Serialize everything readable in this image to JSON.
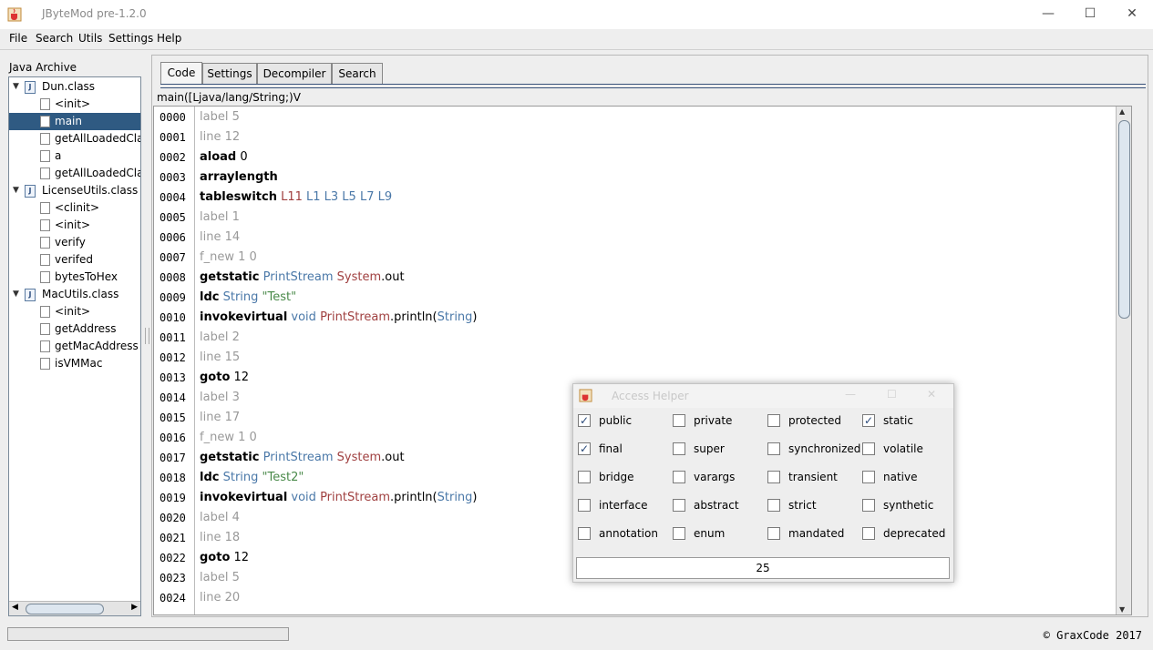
{
  "window": {
    "title": "JByteMod pre-1.2.0",
    "minimize": "—",
    "maximize": "☐",
    "close": "✕"
  },
  "menu": [
    "File",
    "Search",
    "Utils",
    "Settings",
    "Help"
  ],
  "tree": {
    "heading": "Java Archive",
    "rows": [
      {
        "type": "class",
        "label": "Dun.class"
      },
      {
        "type": "method",
        "label": "<init>"
      },
      {
        "type": "method",
        "label": "main",
        "selected": true
      },
      {
        "type": "method",
        "label": "getAllLoadedClasses"
      },
      {
        "type": "method",
        "label": "a"
      },
      {
        "type": "method",
        "label": "getAllLoadedClasses"
      },
      {
        "type": "class",
        "label": "LicenseUtils.class"
      },
      {
        "type": "method",
        "label": "<clinit>"
      },
      {
        "type": "method",
        "label": "<init>"
      },
      {
        "type": "method",
        "label": "verify"
      },
      {
        "type": "method",
        "label": "verifed"
      },
      {
        "type": "method",
        "label": "bytesToHex"
      },
      {
        "type": "class",
        "label": "MacUtils.class"
      },
      {
        "type": "method",
        "label": "<init>"
      },
      {
        "type": "method",
        "label": "getAddress"
      },
      {
        "type": "method",
        "label": "getMacAddress"
      },
      {
        "type": "method",
        "label": "isVMMac"
      }
    ]
  },
  "tabs": [
    "Code",
    "Settings",
    "Decompiler",
    "Search"
  ],
  "method_signature": "main([Ljava/lang/String;)V",
  "code": [
    {
      "num": "0000",
      "parts": [
        [
          "label",
          "label 5"
        ]
      ]
    },
    {
      "num": "0001",
      "parts": [
        [
          "label",
          "line 12"
        ]
      ]
    },
    {
      "num": "0002",
      "parts": [
        [
          "op",
          "aload"
        ],
        [
          "plain",
          " 0"
        ]
      ]
    },
    {
      "num": "0003",
      "parts": [
        [
          "op",
          "arraylength"
        ]
      ]
    },
    {
      "num": "0004",
      "parts": [
        [
          "op",
          "tableswitch"
        ],
        [
          "owner",
          " L11"
        ],
        [
          "type",
          " L1 L3 L5 L7 L9"
        ]
      ]
    },
    {
      "num": "0005",
      "parts": [
        [
          "label",
          "label 1"
        ]
      ]
    },
    {
      "num": "0006",
      "parts": [
        [
          "label",
          "line 14"
        ]
      ]
    },
    {
      "num": "0007",
      "parts": [
        [
          "label",
          "f_new 1 0"
        ]
      ]
    },
    {
      "num": "0008",
      "parts": [
        [
          "op",
          "getstatic"
        ],
        [
          "type",
          " PrintStream"
        ],
        [
          "owner",
          " System"
        ],
        [
          "plain",
          ".out"
        ]
      ]
    },
    {
      "num": "0009",
      "parts": [
        [
          "op",
          "ldc"
        ],
        [
          "type",
          " String"
        ],
        [
          "str",
          " \"Test\""
        ]
      ]
    },
    {
      "num": "0010",
      "parts": [
        [
          "op",
          "invokevirtual"
        ],
        [
          "type",
          " void"
        ],
        [
          "owner",
          " PrintStream"
        ],
        [
          "plain",
          ".println("
        ],
        [
          "type",
          "String"
        ],
        [
          "plain",
          ")"
        ]
      ]
    },
    {
      "num": "0011",
      "parts": [
        [
          "label",
          "label 2"
        ]
      ]
    },
    {
      "num": "0012",
      "parts": [
        [
          "label",
          "line 15"
        ]
      ]
    },
    {
      "num": "0013",
      "parts": [
        [
          "op",
          "goto"
        ],
        [
          "plain",
          " 12"
        ]
      ]
    },
    {
      "num": "0014",
      "parts": [
        [
          "label",
          "label 3"
        ]
      ]
    },
    {
      "num": "0015",
      "parts": [
        [
          "label",
          "line 17"
        ]
      ]
    },
    {
      "num": "0016",
      "parts": [
        [
          "label",
          "f_new 1 0"
        ]
      ]
    },
    {
      "num": "0017",
      "parts": [
        [
          "op",
          "getstatic"
        ],
        [
          "type",
          " PrintStream"
        ],
        [
          "owner",
          " System"
        ],
        [
          "plain",
          ".out"
        ]
      ]
    },
    {
      "num": "0018",
      "parts": [
        [
          "op",
          "ldc"
        ],
        [
          "type",
          " String"
        ],
        [
          "str",
          " \"Test2\""
        ]
      ]
    },
    {
      "num": "0019",
      "parts": [
        [
          "op",
          "invokevirtual"
        ],
        [
          "type",
          " void"
        ],
        [
          "owner",
          " PrintStream"
        ],
        [
          "plain",
          ".println("
        ],
        [
          "type",
          "String"
        ],
        [
          "plain",
          ")"
        ]
      ]
    },
    {
      "num": "0020",
      "parts": [
        [
          "label",
          "label 4"
        ]
      ]
    },
    {
      "num": "0021",
      "parts": [
        [
          "label",
          "line 18"
        ]
      ]
    },
    {
      "num": "0022",
      "parts": [
        [
          "op",
          "goto"
        ],
        [
          "plain",
          " 12"
        ]
      ]
    },
    {
      "num": "0023",
      "parts": [
        [
          "label",
          "label 5"
        ]
      ]
    },
    {
      "num": "0024",
      "parts": [
        [
          "label",
          "line 20"
        ]
      ]
    }
  ],
  "access_helper": {
    "title": "Access Helper",
    "rows": [
      [
        {
          "label": "public",
          "checked": true
        },
        {
          "label": "private",
          "checked": false
        },
        {
          "label": "protected",
          "checked": false
        },
        {
          "label": "static",
          "checked": true
        }
      ],
      [
        {
          "label": "final",
          "checked": true
        },
        {
          "label": "super",
          "checked": false
        },
        {
          "label": "synchronized",
          "checked": false
        },
        {
          "label": "volatile",
          "checked": false
        }
      ],
      [
        {
          "label": "bridge",
          "checked": false
        },
        {
          "label": "varargs",
          "checked": false
        },
        {
          "label": "transient",
          "checked": false
        },
        {
          "label": "native",
          "checked": false
        }
      ],
      [
        {
          "label": "interface",
          "checked": false
        },
        {
          "label": "abstract",
          "checked": false
        },
        {
          "label": "strict",
          "checked": false
        },
        {
          "label": "synthetic",
          "checked": false
        }
      ],
      [
        {
          "label": "annotation",
          "checked": false
        },
        {
          "label": "enum",
          "checked": false
        },
        {
          "label": "mandated",
          "checked": false
        },
        {
          "label": "deprecated",
          "checked": false
        }
      ]
    ],
    "value": "25"
  },
  "status": {
    "copyright": "© GraxCode 2017"
  }
}
